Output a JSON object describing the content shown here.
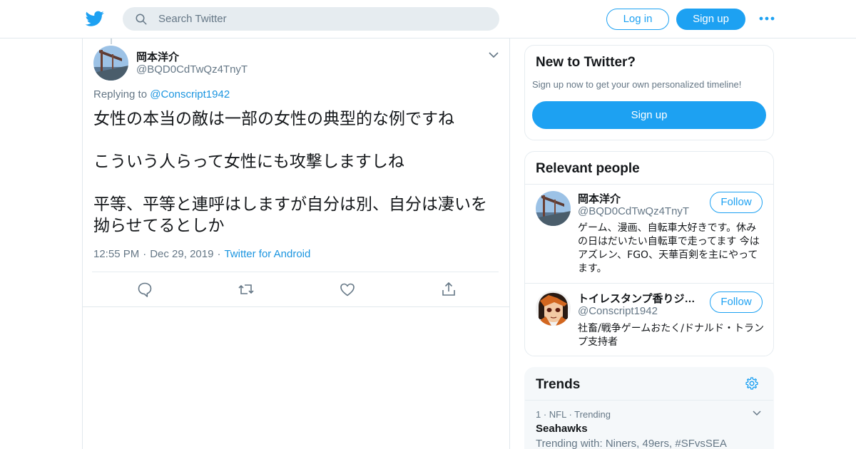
{
  "header": {
    "logo_icon": "twitter-bird-icon",
    "search_placeholder": "Search Twitter",
    "login_label": "Log in",
    "signup_label": "Sign up",
    "more_icon": "more-dots-icon",
    "accent_color": "#1da1f2"
  },
  "tweet": {
    "author_name": "岡本洋介",
    "author_handle": "@BQD0CdTwQz4TnyT",
    "replying_prefix": "Replying to",
    "replying_to": "@Conscript1942",
    "paragraphs": [
      "女性の本当の敵は一部の女性の典型的な例ですね",
      "こういう人らって女性にも攻撃しますしね",
      "平等、平等と連呼はしますが自分は別、自分は凄いを拗らせてるとしか"
    ],
    "time": "12:55 PM",
    "date": "Dec 29, 2019",
    "separator": "·",
    "source": "Twitter for Android",
    "actions": [
      "reply-icon",
      "retweet-icon",
      "like-icon",
      "share-icon"
    ]
  },
  "new_to_twitter": {
    "title": "New to Twitter?",
    "subtitle": "Sign up now to get your own personalized timeline!",
    "signup_label": "Sign up"
  },
  "relevant_people": {
    "title": "Relevant people",
    "people": [
      {
        "name": "岡本洋介",
        "handle": "@BQD0CdTwQz4TnyT",
        "bio": "ゲーム、漫画、自転車大好きです。休みの日はだいたい自転車で走ってます 今はアズレン、FGO、天華百剣を主にやってます。",
        "follow_label": "Follow"
      },
      {
        "name": "トイレスタンプ香りジ…",
        "handle": "@Conscript1942",
        "bio": "社畜/戦争ゲームおたく/ドナルド・トランプ支持者",
        "follow_label": "Follow"
      }
    ]
  },
  "trends": {
    "title": "Trends",
    "items": [
      {
        "meta": "1 · NFL · Trending",
        "name": "Seahawks",
        "with": "Trending with: Niners, 49ers, #SFvsSEA"
      }
    ]
  }
}
